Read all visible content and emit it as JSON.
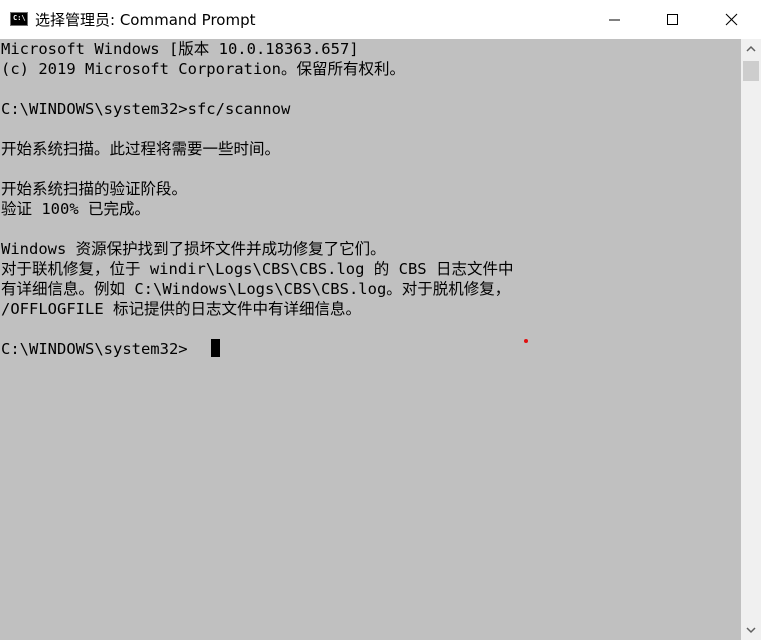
{
  "window": {
    "title": "选择管理员: Command Prompt",
    "icon": "cmd-icon",
    "icon_glyph": "C:\\",
    "buttons": {
      "minimize": "minimize-icon",
      "maximize": "maximize-icon",
      "close": "close-icon"
    }
  },
  "console": {
    "background": "#c0c0c0",
    "foreground": "#000000",
    "lines": [
      "Microsoft Windows [版本 10.0.18363.657]",
      "(c) 2019 Microsoft Corporation。保留所有权利。",
      "",
      "C:\\WINDOWS\\system32>sfc/scannow",
      "",
      "开始系统扫描。此过程将需要一些时间。",
      "",
      "开始系统扫描的验证阶段。",
      "验证 100% 已完成。",
      "",
      "Windows 资源保护找到了损坏文件并成功修复了它们。",
      "对于联机修复，位于 windir\\Logs\\CBS\\CBS.log 的 CBS 日志文件中",
      "有详细信息。例如 C:\\Windows\\Logs\\CBS\\CBS.log。对于脱机修复，",
      "/OFFLOGFILE 标记提供的日志文件中有详细信息。",
      "",
      "C:\\WINDOWS\\system32> "
    ]
  },
  "scrollbar": {
    "up_icon": "scroll-up-arrow-icon",
    "down_icon": "scroll-down-arrow-icon"
  }
}
